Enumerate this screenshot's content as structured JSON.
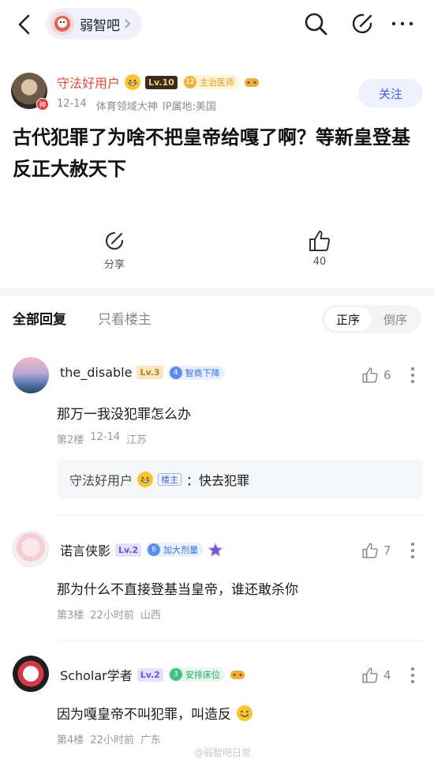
{
  "forum": {
    "name": "弱智吧"
  },
  "post": {
    "author": {
      "name": "守法好用户",
      "level": "Lv.10",
      "title_num": "12",
      "title": "主治医师",
      "avatar_badge": "神",
      "date": "12-14",
      "domain": "体育领域大神",
      "ip": "IP属地:美国"
    },
    "follow_label": "关注",
    "title": "古代犯罪了为啥不把皇帝给嘎了啊？等新皇登基反正大赦天下",
    "share_label": "分享",
    "like_count": "40"
  },
  "tabs": {
    "all": "全部回复",
    "owner_only": "只看楼主"
  },
  "sort": {
    "asc": "正序",
    "desc": "倒序"
  },
  "comments": [
    {
      "name": "the_disable",
      "level": "Lv.3",
      "title_num": "4",
      "title": "智商下降",
      "likes": "6",
      "text": "那万一我没犯罪怎么办",
      "floor": "第2楼",
      "time": "12-14",
      "location": "江苏",
      "sub_reply": {
        "name": "守法好用户",
        "tag": "楼主",
        "text": "：快去犯罪"
      }
    },
    {
      "name": "诺言侠影",
      "level": "Lv.2",
      "title_num": "6",
      "title": "加大剂量",
      "likes": "7",
      "text": "那为什么不直接登基当皇帝，谁还敢杀你",
      "floor": "第3楼",
      "time": "22小时前",
      "location": "山西"
    },
    {
      "name": "Scholar学者",
      "level": "Lv.2",
      "title_num": "3",
      "title": "安排床位",
      "likes": "4",
      "text": "因为嘎皇帝不叫犯罪，叫造反",
      "floor": "第4楼",
      "time": "22小时前",
      "location": "广东"
    }
  ],
  "watermark": "@弱智吧日常"
}
